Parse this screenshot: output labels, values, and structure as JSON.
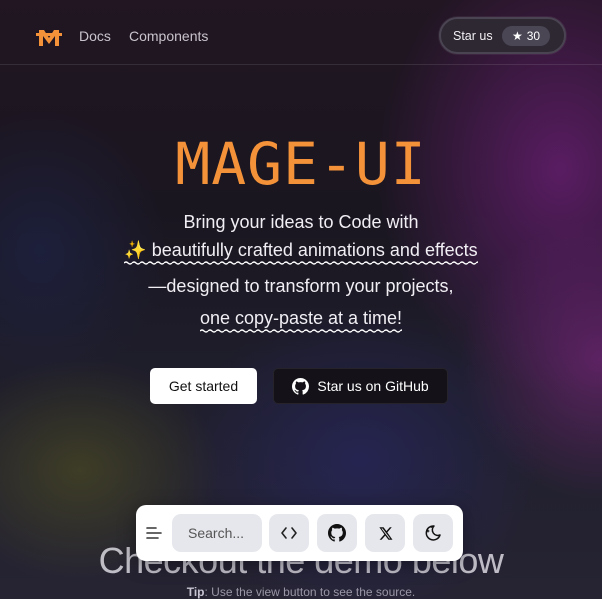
{
  "header": {
    "logo_icon": "mage-ui-logo-icon",
    "nav": {
      "docs": "Docs",
      "components": "Components"
    },
    "star_button": {
      "label": "Star us",
      "count": "30",
      "icon": "star-icon"
    }
  },
  "hero": {
    "title": "MAGE-UI",
    "line1": "Bring your ideas to Code with",
    "line2_emoji": "✨",
    "line2_text": "beautifully crafted animations and effects",
    "line3": "—designed to transform your projects,",
    "line4": "one copy-paste at a time!",
    "primary_button": "Get started",
    "secondary_button": "Star us on GitHub",
    "secondary_icon": "github-icon"
  },
  "demo": {
    "title": "Checkout the demo below",
    "tip_label": "Tip",
    "tip_text": ": Use the view button to see the source."
  },
  "toolbar": {
    "menu_icon": "menu-icon",
    "search_placeholder": "Search...",
    "code_icon": "code-icon",
    "github_icon": "github-icon",
    "x_icon": "x-logo-icon",
    "theme_icon": "theme-toggle-icon"
  },
  "colors": {
    "accent_orange": "#f4923a",
    "primary_button_bg": "#ffffff",
    "secondary_button_bg": "#141218",
    "toolbar_bg": "#ffffff",
    "toolbar_button_bg": "#e6e7ec"
  }
}
